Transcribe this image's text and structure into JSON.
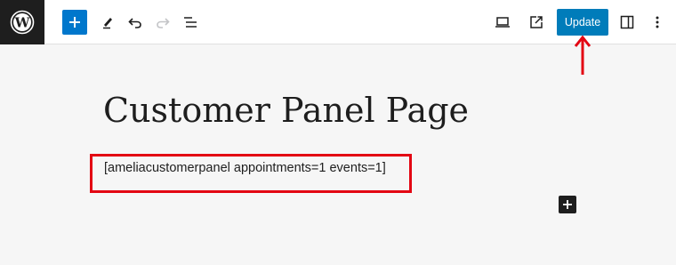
{
  "toolbar": {
    "buttons": [
      {
        "name": "add-block",
        "icon": "plus-icon"
      },
      {
        "name": "tools",
        "icon": "pencil-icon"
      },
      {
        "name": "undo",
        "icon": "undo-icon"
      },
      {
        "name": "redo",
        "icon": "redo-icon"
      },
      {
        "name": "document-overview",
        "icon": "list-view-icon"
      }
    ],
    "right_buttons": [
      {
        "name": "preview",
        "icon": "desktop-icon"
      },
      {
        "name": "view-page",
        "icon": "external-link-icon"
      },
      {
        "name": "settings",
        "icon": "sidebar-icon"
      },
      {
        "name": "options",
        "icon": "vertical-ellipsis-icon"
      }
    ],
    "update_label": "Update",
    "accent_color": "#007cba"
  },
  "editor": {
    "title": "Customer Panel Page",
    "shortcode": "[ameliacustomerpanel appointments=1 events=1]",
    "highlight_color": "#e30613"
  }
}
